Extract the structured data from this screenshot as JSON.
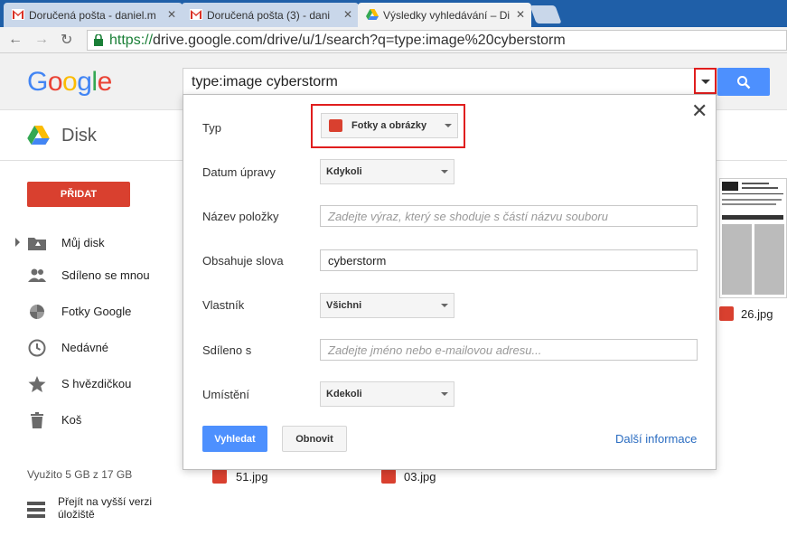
{
  "browser": {
    "tabs": [
      {
        "title": "Doručená pošta - daniel.m"
      },
      {
        "title": "Doručená pošta (3) - dani"
      },
      {
        "title": "Výsledky vyhledávání – Di"
      }
    ],
    "url_https": "https://",
    "url_rest": "drive.google.com/drive/u/1/search?q=type:image%20cyberstorm"
  },
  "header": {
    "logo": [
      "G",
      "o",
      "o",
      "g",
      "l",
      "e"
    ],
    "logo_colors": [
      "#4285f4",
      "#ea4335",
      "#fbbc05",
      "#4285f4",
      "#34a853",
      "#ea4335"
    ],
    "search_query": "type:image cyberstorm"
  },
  "drive": {
    "title": "Disk"
  },
  "sidebar": {
    "new_label": "PŘIDAT",
    "items": [
      {
        "label": "Můj disk",
        "icon": "folder-drive-icon"
      },
      {
        "label": "Sdíleno se mnou",
        "icon": "people-icon"
      },
      {
        "label": "Fotky Google",
        "icon": "pinwheel-icon"
      },
      {
        "label": "Nedávné",
        "icon": "clock-icon"
      },
      {
        "label": "S hvězdičkou",
        "icon": "star-icon"
      },
      {
        "label": "Koš",
        "icon": "trash-icon"
      }
    ],
    "storage": "Využito 5 GB z 17 GB",
    "upgrade": "Přejít na vyšší verzi úložiště"
  },
  "files": [
    {
      "name": "26.jpg"
    },
    {
      "name": "51.jpg"
    },
    {
      "name": "03.jpg"
    }
  ],
  "advanced": {
    "type_label": "Typ",
    "type_value": "Fotky a obrázky",
    "modified_label": "Datum úpravy",
    "modified_value": "Kdykoli",
    "name_label": "Název položky",
    "name_placeholder": "Zadejte výraz, který se shoduje s částí názvu souboru",
    "words_label": "Obsahuje slova",
    "words_value": "cyberstorm",
    "owner_label": "Vlastník",
    "owner_value": "Všichni",
    "shared_label": "Sdíleno s",
    "shared_placeholder": "Zadejte jméno nebo e-mailovou adresu...",
    "location_label": "Umístění",
    "location_value": "Kdekoli",
    "search_button": "Vyhledat",
    "reset_button": "Obnovit",
    "more_info": "Další informace"
  },
  "colors": {
    "accent_blue": "#4d90fe",
    "new_button_red": "#d9402f",
    "highlight_red": "#e01e1e"
  }
}
